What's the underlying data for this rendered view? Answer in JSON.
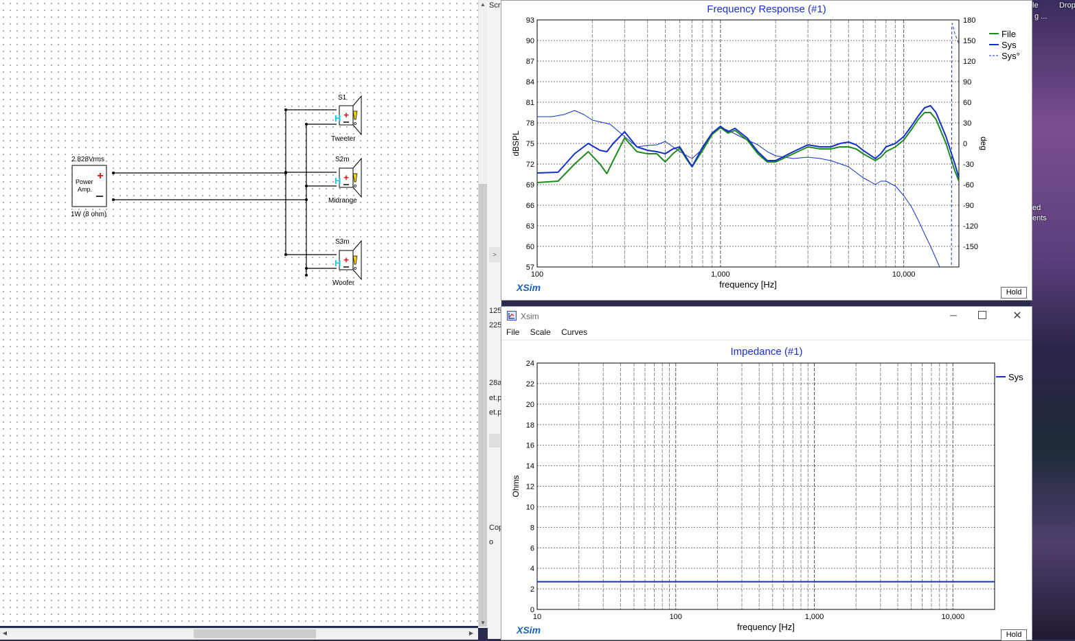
{
  "schematic": {
    "amp": {
      "voltage": "2.828Vrms",
      "label_line1": "Power",
      "label_line2": "Amp.",
      "power": "1W (8 ohm)"
    },
    "speakers": [
      {
        "id": "S1",
        "name": "Tweeter"
      },
      {
        "id": "S2m",
        "name": "Midrange"
      },
      {
        "id": "S3m",
        "name": "Woofer"
      }
    ],
    "h_marker": "H"
  },
  "background_window": {
    "texts": [
      "Scr",
      "125",
      "225",
      "28a",
      "et.p",
      "et.p",
      "Cop",
      "o"
    ]
  },
  "desktop": {
    "texts": [
      "le",
      "Drop",
      "g ...",
      "ed",
      "ents"
    ]
  },
  "freq_window": {
    "title": "Frequency Response (#1)",
    "ylabel_left": "dBSPL",
    "ylabel_right": "deg",
    "xlabel": "frequency [Hz]",
    "yticks_left": [
      "93",
      "90",
      "87",
      "84",
      "81",
      "78",
      "75",
      "72",
      "69",
      "66",
      "63",
      "60",
      "57"
    ],
    "yticks_right": [
      "180",
      "150",
      "120",
      "90",
      "60",
      "30",
      "0",
      "-30",
      "-60",
      "-90",
      "-120",
      "-150"
    ],
    "xticks": [
      "100",
      "1,000",
      "10,000"
    ],
    "legend": [
      "File",
      "Sys",
      "Sys°"
    ],
    "brand": "XSim",
    "hold_label": "Hold"
  },
  "imp_window": {
    "app_title": "Xsim",
    "menu": [
      "File",
      "Scale",
      "Curves"
    ],
    "title": "Impedance (#1)",
    "ylabel": "Ohms",
    "xlabel": "frequency [Hz]",
    "yticks": [
      "24",
      "22",
      "20",
      "18",
      "16",
      "14",
      "12",
      "10",
      "8",
      "6",
      "4",
      "2",
      "0"
    ],
    "xticks": [
      "10",
      "100",
      "1,000",
      "10,000"
    ],
    "legend": [
      "Sys"
    ],
    "brand": "XSim",
    "hold_label": "Hold"
  },
  "chart_data": [
    {
      "type": "line",
      "title": "Frequency Response (#1)",
      "xlabel": "frequency [Hz]",
      "ylabel": "dBSPL",
      "y2label": "deg",
      "xscale": "log",
      "xlim": [
        100,
        20000
      ],
      "ylim": [
        57,
        93
      ],
      "y2lim": [
        -180,
        180
      ],
      "grid": true,
      "legend_position": "top-right",
      "colors": {
        "File": "#1b8a1b",
        "Sys": "#1230c8",
        "Sys°": "#1230c8"
      },
      "series": [
        {
          "name": "File",
          "axis": "left",
          "x": [
            100,
            130,
            160,
            190,
            220,
            240,
            260,
            300,
            350,
            400,
            450,
            500,
            550,
            600,
            650,
            700,
            800,
            900,
            1000,
            1100,
            1200,
            1400,
            1600,
            1800,
            2000,
            2500,
            3000,
            3500,
            4000,
            4500,
            5000,
            5500,
            6000,
            7000,
            7500,
            8000,
            9000,
            10000,
            11000,
            12000,
            13000,
            14000,
            15000,
            17000,
            19000,
            20000
          ],
          "y": [
            69.3,
            69.5,
            72,
            73.8,
            72,
            70.6,
            72.5,
            75.8,
            73.8,
            73.5,
            73.5,
            72.3,
            73.5,
            74.3,
            72.8,
            71.6,
            74,
            76.3,
            77.3,
            76.5,
            76.9,
            75.5,
            73.5,
            72.3,
            72.3,
            73.5,
            74.5,
            74.2,
            74.2,
            74.5,
            74.5,
            74.2,
            73.5,
            72.5,
            73,
            73.8,
            74.5,
            75.5,
            77,
            78.5,
            79.5,
            79.5,
            78.5,
            75,
            71,
            69.5
          ]
        },
        {
          "name": "Sys",
          "axis": "left",
          "x": [
            100,
            130,
            160,
            190,
            220,
            240,
            260,
            300,
            350,
            400,
            450,
            500,
            550,
            600,
            650,
            700,
            800,
            900,
            1000,
            1100,
            1200,
            1400,
            1600,
            1800,
            2000,
            2500,
            3000,
            3500,
            4000,
            4500,
            5000,
            5500,
            6000,
            7000,
            7500,
            8000,
            9000,
            10000,
            11000,
            12000,
            13000,
            14000,
            15000,
            17000,
            19000,
            20000
          ],
          "y": [
            70.7,
            70.8,
            73.5,
            75,
            74,
            73.8,
            75,
            76.7,
            74.5,
            74,
            73.8,
            73.5,
            74.2,
            74.5,
            73,
            71.6,
            74.5,
            76.5,
            77.5,
            76.7,
            77.2,
            75.8,
            73.8,
            72.5,
            72.5,
            73.8,
            74.8,
            74.5,
            74.5,
            75,
            75.2,
            74.8,
            74,
            72.8,
            73.5,
            74.5,
            75,
            76,
            77.5,
            79,
            80.2,
            80.5,
            79.5,
            76,
            72,
            70
          ]
        },
        {
          "name": "Sys°",
          "axis": "right",
          "style": "dashed",
          "x": [
            18200,
            18300,
            18400,
            19000,
            20000
          ],
          "y": [
            -177,
            170,
            175,
            160,
            145
          ]
        }
      ],
      "unlabeled_series": [
        {
          "axis": "right",
          "x": [
            100,
            120,
            140,
            160,
            180,
            200,
            250,
            300,
            350,
            400,
            450,
            500,
            600,
            700,
            800,
            900,
            1000,
            1200,
            1400,
            1600,
            1800,
            2000,
            2500,
            3000,
            3500,
            4000,
            5000,
            6000,
            6500,
            7000,
            7500,
            8000,
            9000,
            10000,
            11000,
            12000,
            13000,
            14000,
            15000,
            16000,
            17000,
            18000
          ],
          "y": [
            39,
            39,
            42,
            48,
            42,
            34,
            28,
            10,
            -5,
            -3,
            -2,
            3,
            -12,
            -22,
            -8,
            14,
            24,
            14,
            5,
            -2,
            -12,
            -18,
            -22,
            -20,
            -22,
            -25,
            -34,
            -50,
            -55,
            -60,
            -55,
            -55,
            -62,
            -76,
            -92,
            -112,
            -132,
            -150,
            -168,
            -185,
            -205,
            -220
          ]
        }
      ]
    },
    {
      "type": "line",
      "title": "Impedance (#1)",
      "xlabel": "frequency [Hz]",
      "ylabel": "Ohms",
      "xscale": "log",
      "xlim": [
        10,
        20000
      ],
      "ylim": [
        0,
        24
      ],
      "grid": true,
      "legend_position": "top-right",
      "colors": {
        "Sys": "#1230c8"
      },
      "series": [
        {
          "name": "Sys",
          "x": [
            10,
            20000
          ],
          "y": [
            2.7,
            2.7
          ]
        }
      ]
    }
  ]
}
